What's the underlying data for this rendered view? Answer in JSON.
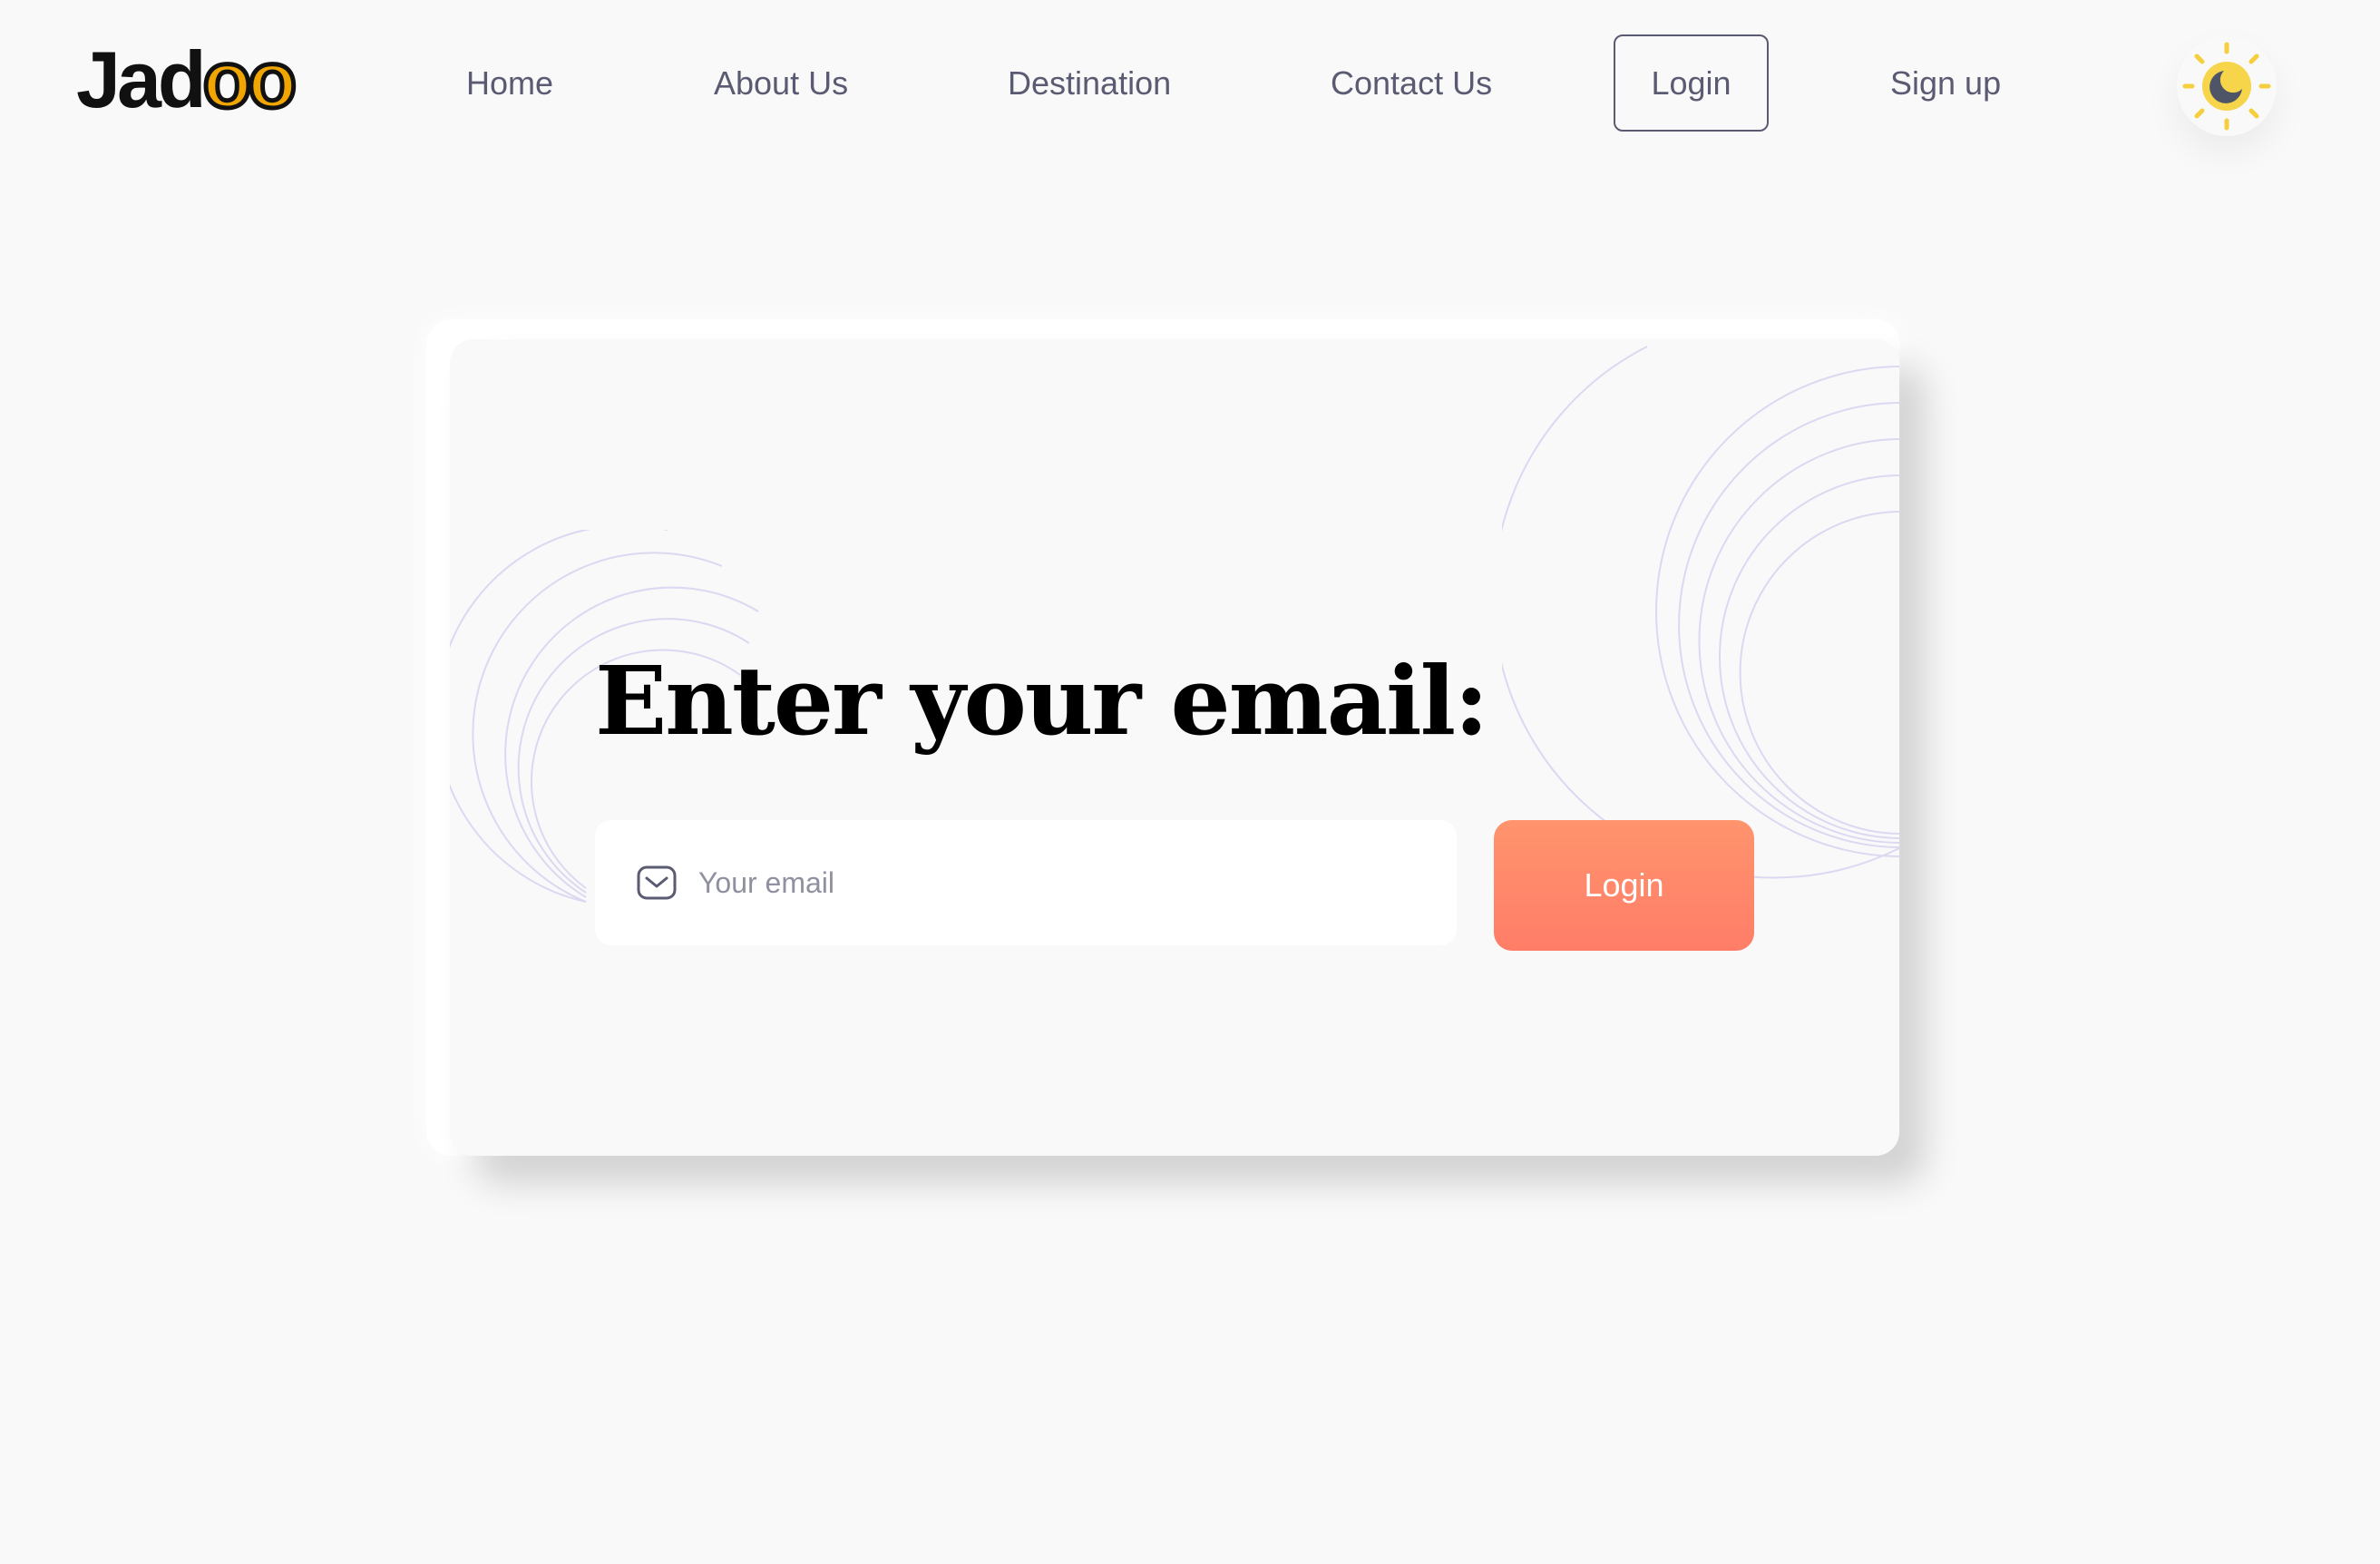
{
  "brand": {
    "logo_prefix": "Jad",
    "logo_suffix": "oo"
  },
  "nav": {
    "home": "Home",
    "about": "About Us",
    "destination": "Destination",
    "contact": "Contact Us",
    "login": "Login",
    "signup": "Sign up"
  },
  "theme_toggle": {
    "icon": "sun-moon-icon"
  },
  "form": {
    "title": "Enter your email:",
    "email_placeholder": "Your email",
    "email_value": "",
    "submit_label": "Login"
  },
  "colors": {
    "accent_gradient_start": "#ff946d",
    "accent_gradient_end": "#ff7d68",
    "nav_text": "#5a5b72",
    "logo_dots": "#f1a501",
    "background": "#f9f9f9"
  }
}
